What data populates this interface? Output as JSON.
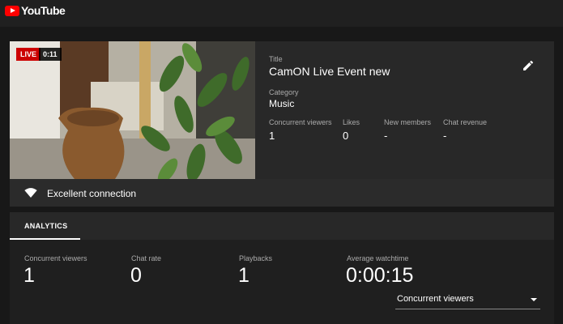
{
  "app": {
    "logo_text": "YouTube"
  },
  "stream": {
    "live_badge": "LIVE",
    "elapsed": "0:11",
    "title_label": "Title",
    "title": "CamON Live Event new",
    "category_label": "Category",
    "category": "Music"
  },
  "stats": [
    {
      "label": "Concurrent viewers",
      "value": "1"
    },
    {
      "label": "Likes",
      "value": "0"
    },
    {
      "label": "New members",
      "value": "-"
    },
    {
      "label": "Chat revenue",
      "value": "-"
    }
  ],
  "connection": {
    "status": "Excellent connection"
  },
  "tabs": [
    {
      "label": "ANALYTICS",
      "active": true
    }
  ],
  "analytics": {
    "metrics": [
      {
        "label": "Concurrent viewers",
        "value": "1"
      },
      {
        "label": "Chat rate",
        "value": "0"
      },
      {
        "label": "Playbacks",
        "value": "1"
      },
      {
        "label": "Average watchtime",
        "value": "0:00:15"
      }
    ],
    "dropdown_selected": "Concurrent viewers"
  },
  "icons": {
    "logo": "youtube-logo-icon",
    "edit": "pencil-icon",
    "connection": "wifi-signal-icon",
    "dropdown": "caret-down-icon"
  },
  "colors": {
    "live_red": "#cc0000",
    "brand_red": "#ff0000",
    "background": "#181818",
    "card": "#282828"
  }
}
